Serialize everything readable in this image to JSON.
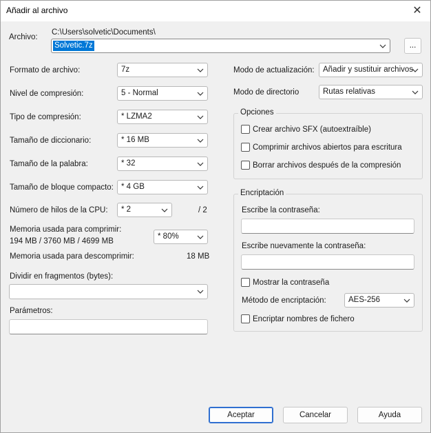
{
  "window": {
    "title": "Añadir al archivo"
  },
  "archive": {
    "label": "Archivo:",
    "folder": "C:\\Users\\solvetic\\Documents\\",
    "name": "Solvetic.7z",
    "browse_label": "..."
  },
  "left": {
    "format_label": "Formato de archivo:",
    "format_value": "7z",
    "level_label": "Nivel de compresión:",
    "level_value": "5 - Normal",
    "method_label": "Tipo de compresión:",
    "method_value": "*  LZMA2",
    "dict_label": "Tamaño de diccionario:",
    "dict_value": "*  16 MB",
    "word_label": "Tamaño de la palabra:",
    "word_value": "*  32",
    "solid_label": "Tamaño de bloque compacto:",
    "solid_value": "*  4 GB",
    "threads_label": "Número de hilos de la CPU:",
    "threads_value": "*  2",
    "threads_max": "/ 2",
    "mem_comp_label_1": "Memoria usada para comprimir:",
    "mem_comp_label_2": "194 MB / 3760 MB / 4699 MB",
    "mem_comp_value": "* 80%",
    "mem_decomp_label": "Memoria usada para descomprimir:",
    "mem_decomp_value": "18 MB",
    "split_label": "Dividir en fragmentos (bytes):",
    "split_value": "",
    "params_label": "Parámetros:",
    "params_value": ""
  },
  "right": {
    "update_label": "Modo de actualización:",
    "update_value": "Añadir y sustituir archivos",
    "pathmode_label": "Modo de directorio",
    "pathmode_value": "Rutas relativas",
    "options_title": "Opciones",
    "opt_sfx": "Crear archivo SFX (autoextraíble)",
    "opt_shared": "Comprimir archivos abiertos para escritura",
    "opt_delete": "Borrar archivos después de la compresión",
    "enc_title": "Encriptación",
    "pwd_label": "Escribe la contraseña:",
    "pwd2_label": "Escribe nuevamente la contraseña:",
    "show_pwd": "Mostrar la contraseña",
    "enc_method_label": "Método de encriptación:",
    "enc_method_value": "AES-256",
    "enc_names": "Encriptar nombres de fichero"
  },
  "buttons": {
    "ok": "Aceptar",
    "cancel": "Cancelar",
    "help": "Ayuda"
  }
}
